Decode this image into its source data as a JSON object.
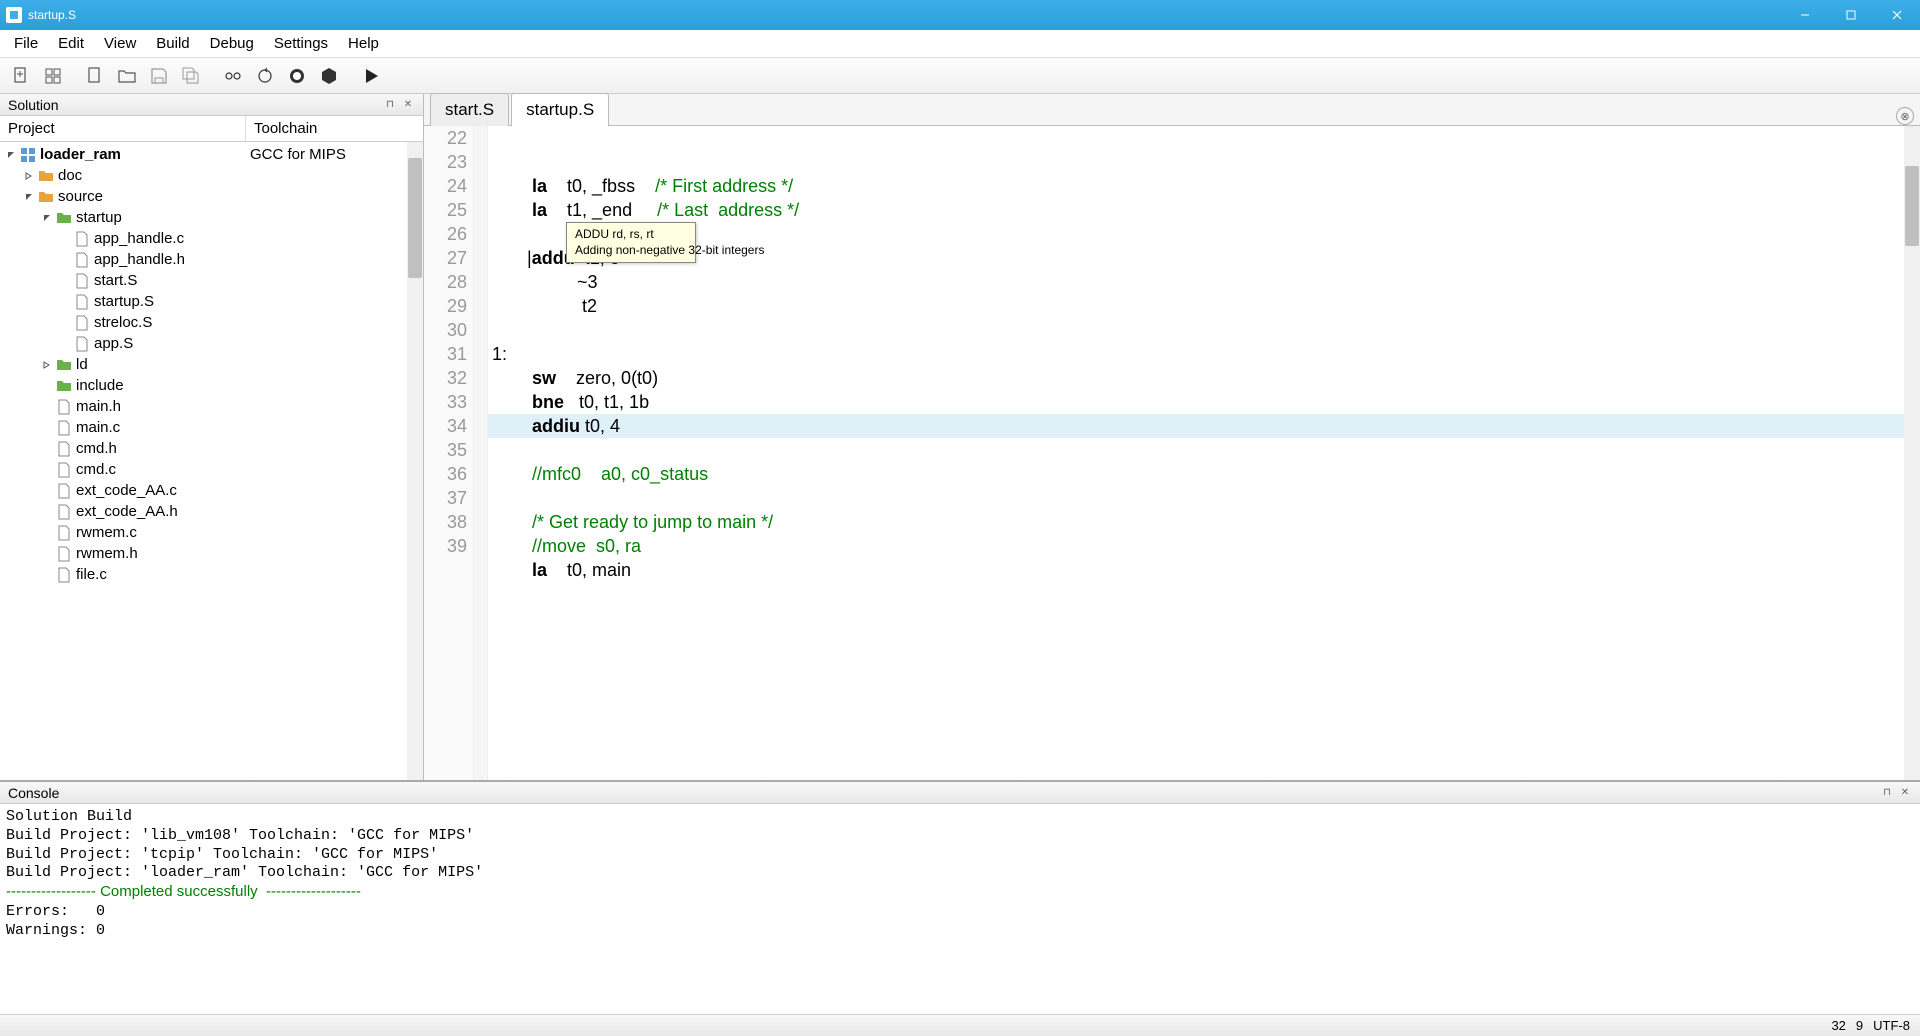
{
  "window": {
    "title": "startup.S"
  },
  "menu": [
    "File",
    "Edit",
    "View",
    "Build",
    "Debug",
    "Settings",
    "Help"
  ],
  "panels": {
    "solution": {
      "title": "Solution",
      "col_project": "Project",
      "col_toolchain": "Toolchain",
      "toolchain_value": "GCC for MIPS"
    },
    "console": {
      "title": "Console"
    }
  },
  "tree": {
    "root": "loader_ram",
    "items": [
      {
        "label": "doc",
        "type": "folder",
        "depth": 1,
        "exp": false
      },
      {
        "label": "source",
        "type": "folder",
        "depth": 1,
        "exp": true
      },
      {
        "label": "startup",
        "type": "folder-green",
        "depth": 2,
        "exp": true
      },
      {
        "label": "app_handle.c",
        "type": "file",
        "depth": 3
      },
      {
        "label": "app_handle.h",
        "type": "file",
        "depth": 3
      },
      {
        "label": "start.S",
        "type": "file",
        "depth": 3
      },
      {
        "label": "startup.S",
        "type": "file",
        "depth": 3
      },
      {
        "label": "streloc.S",
        "type": "file",
        "depth": 3
      },
      {
        "label": "app.S",
        "type": "file",
        "depth": 3
      },
      {
        "label": "ld",
        "type": "folder-green",
        "depth": 2,
        "exp": false
      },
      {
        "label": "include",
        "type": "folder-green",
        "depth": 2,
        "exp": null
      },
      {
        "label": "main.h",
        "type": "file",
        "depth": 2
      },
      {
        "label": "main.c",
        "type": "file",
        "depth": 2
      },
      {
        "label": "cmd.h",
        "type": "file",
        "depth": 2
      },
      {
        "label": "cmd.c",
        "type": "file",
        "depth": 2
      },
      {
        "label": "ext_code_AA.c",
        "type": "file",
        "depth": 2
      },
      {
        "label": "ext_code_AA.h",
        "type": "file",
        "depth": 2
      },
      {
        "label": "rwmem.c",
        "type": "file",
        "depth": 2
      },
      {
        "label": "rwmem.h",
        "type": "file",
        "depth": 2
      },
      {
        "label": "file.c",
        "type": "file",
        "depth": 2
      }
    ]
  },
  "tabs": [
    "start.S",
    "startup.S"
  ],
  "active_tab": 1,
  "code": {
    "first_line": 22,
    "lines": [
      {
        "n": 22,
        "html": "        <span class='kw'>la</span>    t0, _fbss    <span class='cm'>/* First address */</span>"
      },
      {
        "n": 23,
        "html": "        <span class='kw'>la</span>    t1, _end     <span class='cm'>/* Last  address */</span>"
      },
      {
        "n": 24,
        "html": ""
      },
      {
        "n": 25,
        "html": "       <span class='lbl'>|</span><span class='kw'>addu</span>  t1, 3"
      },
      {
        "n": 26,
        "html": "                 ~3"
      },
      {
        "n": 27,
        "html": "                  t2"
      },
      {
        "n": 28,
        "html": ""
      },
      {
        "n": 29,
        "html": "<span class='lbl'>1:</span>"
      },
      {
        "n": 30,
        "html": "        <span class='kw'>sw</span>    zero, 0(t0)"
      },
      {
        "n": 31,
        "html": "        <span class='kw'>bne</span>   t0, t1, 1b"
      },
      {
        "n": 32,
        "html": "        <span class='kw'>addiu</span> t0, 4",
        "hl": true
      },
      {
        "n": 33,
        "html": ""
      },
      {
        "n": 34,
        "html": "        <span class='cm'>//mfc0    a0, c0_status</span>"
      },
      {
        "n": 35,
        "html": ""
      },
      {
        "n": 36,
        "html": "        <span class='cm'>/* Get ready to jump to main */</span>"
      },
      {
        "n": 37,
        "html": "        <span class='cm'>//move  s0, ra</span>"
      },
      {
        "n": 38,
        "html": "        <span class='kw'>la</span>    t0, main"
      },
      {
        "n": 39,
        "html": ""
      }
    ]
  },
  "tooltip": {
    "title": "ADDU rd, rs, rt",
    "desc": "Adding non-negative 32-bit integers"
  },
  "console": {
    "lines": [
      "Solution Build",
      "Build Project: 'lib_vm108' Toolchain: 'GCC for MIPS'",
      "Build Project: 'tcpip' Toolchain: 'GCC for MIPS'",
      "Build Project: 'loader_ram' Toolchain: 'GCC for MIPS'"
    ],
    "completed": "------------------ Completed successfully  -------------------",
    "errors_label": "Errors:   0",
    "warnings_label": "Warnings: 0"
  },
  "status": {
    "line": "32",
    "col": "9",
    "encoding": "UTF-8"
  }
}
